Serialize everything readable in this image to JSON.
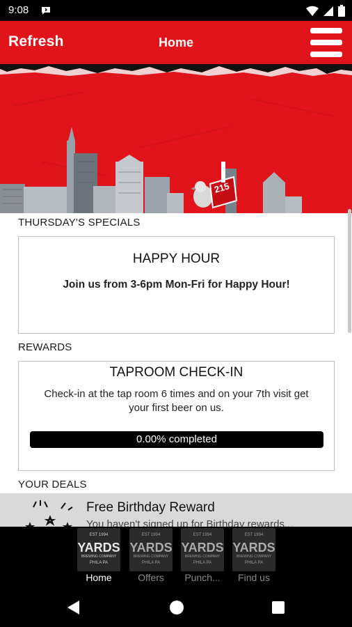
{
  "status_bar": {
    "time": "9:08"
  },
  "app_bar": {
    "refresh_label": "Refresh",
    "title": "Home"
  },
  "specials": {
    "section_label": "THURSDAY'S SPECIALS",
    "card_title": "HAPPY HOUR",
    "card_text": "Join us from 3-6pm Mon-Fri for Happy Hour!"
  },
  "rewards": {
    "section_label": "REWARDS",
    "card_title": "TAPROOM CHECK-IN",
    "card_text_line1": "Check-in at the tap room 6 times and on your 7th visit get",
    "card_text_line2": "your first beer on us.",
    "progress_value": 0.0,
    "progress_label": "0.00% completed"
  },
  "deals": {
    "section_label": "YOUR DEALS",
    "items": [
      {
        "title": "Free Birthday Reward",
        "subtitle": "You haven't signed up for Birthday rewards..."
      }
    ]
  },
  "hero": {
    "badge_text": "215"
  },
  "tabbar": {
    "logo_text": {
      "est": "EST 1994",
      "brand": "YARDS",
      "sub": "BREWING COMPANY",
      "city": "PHILA PA"
    },
    "tabs": [
      {
        "label": "Home",
        "active": true
      },
      {
        "label": "Offers",
        "active": false
      },
      {
        "label": "Punch...",
        "active": false
      },
      {
        "label": "Find us",
        "active": false
      }
    ]
  },
  "colors": {
    "brand_red": "#e1141b",
    "tab_active": "#ffffff",
    "tab_inactive": "#8a8a8a"
  },
  "icons": [
    "chat-bubble-icon",
    "wifi-icon",
    "signal-icon",
    "battery-icon",
    "hamburger-menu-icon",
    "fireworks-icon",
    "back-icon",
    "home-circle-icon",
    "recents-icon"
  ]
}
